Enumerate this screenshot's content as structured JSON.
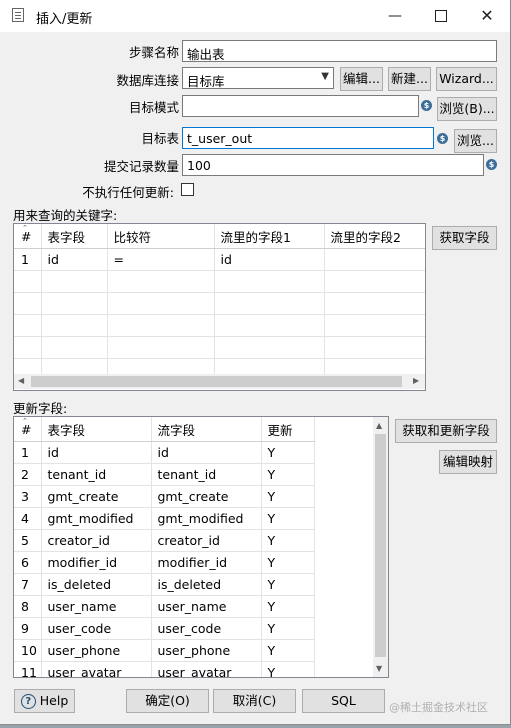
{
  "window": {
    "title": "插入/更新",
    "minimize": "—",
    "close": "✕"
  },
  "form": {
    "step_name_label": "步骤名称",
    "step_name_value": "输出表",
    "db_conn_label": "数据库连接",
    "db_conn_value": "目标库",
    "edit_button": "编辑...",
    "new_button": "新建...",
    "wizard_button": "Wizard...",
    "target_schema_label": "目标模式",
    "target_schema_value": "",
    "browse_schema_button": "浏览(B)...",
    "target_table_label": "目标表",
    "target_table_value": "t_user_out",
    "browse_table_button": "浏览...",
    "commit_size_label": "提交记录数量",
    "commit_size_value": "100",
    "no_update_label": "不执行任何更新:",
    "no_update_checked": false,
    "var_icon": "$"
  },
  "key_section": {
    "label": "用来查询的关键字:",
    "get_fields_button": "获取字段",
    "headers": [
      "#",
      "表字段",
      "比较符",
      "流里的字段1",
      "流里的字段2"
    ],
    "rows": [
      [
        "1",
        "id",
        "=",
        "id",
        ""
      ]
    ]
  },
  "update_section": {
    "label": "更新字段:",
    "get_update_fields_button": "获取和更新字段",
    "edit_mapping_button": "编辑映射",
    "headers": [
      "#",
      "表字段",
      "流字段",
      "更新"
    ],
    "rows": [
      [
        "1",
        "id",
        "id",
        "Y"
      ],
      [
        "2",
        "tenant_id",
        "tenant_id",
        "Y"
      ],
      [
        "3",
        "gmt_create",
        "gmt_create",
        "Y"
      ],
      [
        "4",
        "gmt_modified",
        "gmt_modified",
        "Y"
      ],
      [
        "5",
        "creator_id",
        "creator_id",
        "Y"
      ],
      [
        "6",
        "modifier_id",
        "modifier_id",
        "Y"
      ],
      [
        "7",
        "is_deleted",
        "is_deleted",
        "Y"
      ],
      [
        "8",
        "user_name",
        "user_name",
        "Y"
      ],
      [
        "9",
        "user_code",
        "user_code",
        "Y"
      ],
      [
        "10",
        "user_phone",
        "user_phone",
        "Y"
      ],
      [
        "11",
        "user_avatar",
        "user_avatar",
        "Y"
      ]
    ]
  },
  "footer": {
    "help_button": "Help",
    "help_icon": "?",
    "ok_button": "确定(O)",
    "cancel_button": "取消(C)",
    "sql_button": "SQL"
  },
  "watermark": "@稀土掘金技术社区"
}
